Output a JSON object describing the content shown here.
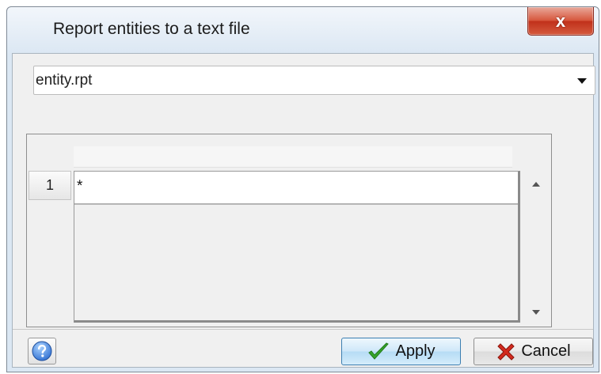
{
  "window": {
    "title": "Report entities to a text file",
    "close_label": "x"
  },
  "file_combo": {
    "value": "entity.rpt"
  },
  "grid": {
    "rows": [
      {
        "number": "1",
        "value": "*"
      }
    ]
  },
  "footer": {
    "apply_label": "Apply",
    "cancel_label": "Cancel"
  },
  "icons": {
    "help": "help-icon",
    "apply": "check-icon",
    "cancel": "x-icon"
  },
  "colors": {
    "close_button": "#c7402a",
    "apply_border": "#3c7fb1",
    "check_green": "#35a52a",
    "cancel_red": "#d32a1e",
    "help_blue": "#2f6fd1"
  }
}
